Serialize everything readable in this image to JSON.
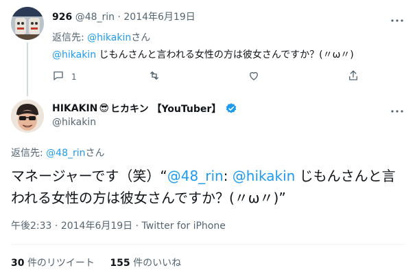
{
  "reply": {
    "display_name": "926",
    "handle": "@48_rin",
    "separator": "·",
    "date": "2014年6月19日",
    "reply_to_prefix": "返信先: ",
    "reply_to_user": "@hikakin",
    "reply_to_suffix": "さん",
    "text_mention": "@hikakin",
    "text": " じもんさんと言われる女性の方は彼女さんですか？(〃ω〃)",
    "reply_count": "1"
  },
  "main": {
    "name_part1": "HIKAKIN",
    "name_emoji": "😎",
    "name_part2": "ヒカキン 【YouTuber】",
    "handle": "@hikakin",
    "reply_to_prefix": "返信先: ",
    "reply_to_user": "@48_rin",
    "reply_to_suffix": "さん",
    "text_before": "マネージャーです（笑）“",
    "text_mention1": "@48_rin",
    "text_colon": ": ",
    "text_mention2": "@hikakin",
    "text_after": " じもんさんと言われる女性の方は彼女さんですか？(〃ω〃)”",
    "time": "午後2:33",
    "separator": " · ",
    "date": "2014年6月19日",
    "source": "Twitter for iPhone",
    "retweet_count": "30",
    "retweet_label": "件のリツイート",
    "like_count": "155",
    "like_label": "件のいいね"
  },
  "colors": {
    "link": "#1d9bf0",
    "muted": "#536471",
    "verified": "#1d9bf0"
  }
}
